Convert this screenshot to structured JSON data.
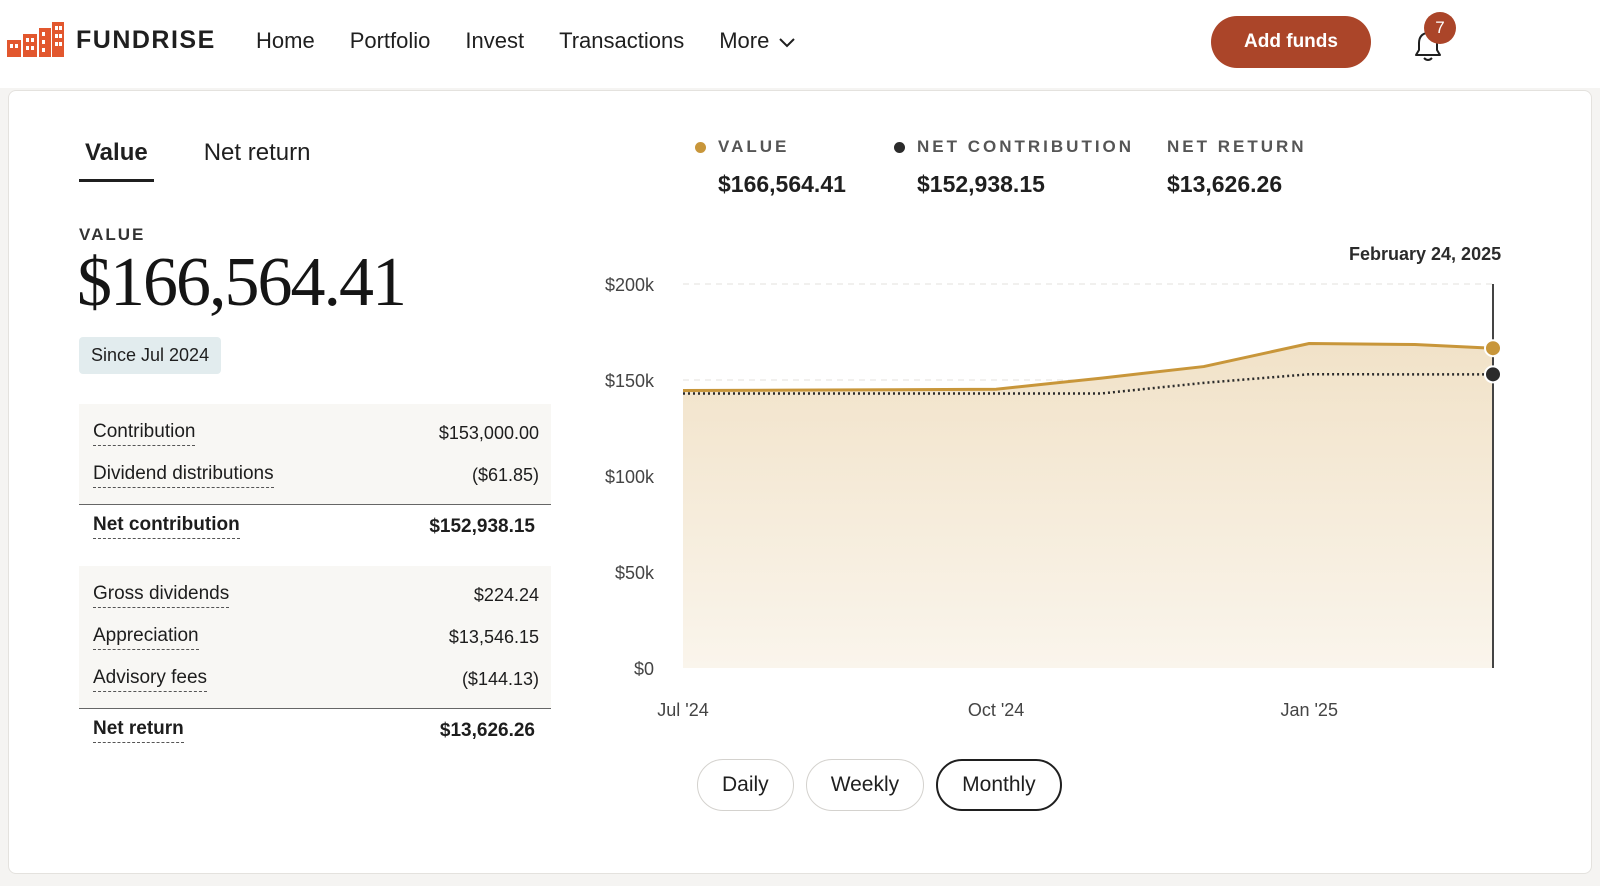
{
  "header": {
    "brand": "FUNDRISE",
    "nav": [
      {
        "label": "Home"
      },
      {
        "label": "Portfolio"
      },
      {
        "label": "Invest"
      },
      {
        "label": "Transactions"
      },
      {
        "label": "More"
      }
    ],
    "add_funds_label": "Add funds",
    "notification_count": "7"
  },
  "tabs": [
    {
      "label": "Value",
      "active": true
    },
    {
      "label": "Net return",
      "active": false
    }
  ],
  "summary": {
    "value_label": "VALUE",
    "value": "$166,564.41",
    "since": "Since Jul 2024"
  },
  "breakdown": {
    "contributions": [
      {
        "label": "Contribution",
        "value": "$153,000.00"
      },
      {
        "label": "Dividend distributions",
        "value": "($61.85)"
      }
    ],
    "net_contribution": {
      "label": "Net contribution",
      "value": "$152,938.15"
    },
    "returns": [
      {
        "label": "Gross dividends",
        "value": "$224.24"
      },
      {
        "label": "Appreciation",
        "value": "$13,546.15"
      },
      {
        "label": "Advisory fees",
        "value": "($144.13)"
      }
    ],
    "net_return": {
      "label": "Net return",
      "value": "$13,626.26"
    }
  },
  "legend": [
    {
      "label": "VALUE",
      "value": "$166,564.41",
      "color": "#c8963a"
    },
    {
      "label": "NET CONTRIBUTION",
      "value": "$152,938.15",
      "color": "#2b2b2b"
    },
    {
      "label": "NET RETURN",
      "value": "$13,626.26",
      "color": ""
    }
  ],
  "chart_data": {
    "type": "area",
    "x": [
      "2024-07-01",
      "2024-08-01",
      "2024-09-01",
      "2024-10-01",
      "2024-11-01",
      "2024-12-01",
      "2025-01-01",
      "2025-02-01",
      "2025-02-24"
    ],
    "x_tick_labels": [
      {
        "date": "2024-07-01",
        "label": "Jul '24"
      },
      {
        "date": "2024-10-01",
        "label": "Oct '24"
      },
      {
        "date": "2025-01-01",
        "label": "Jan '25"
      }
    ],
    "series": [
      {
        "name": "VALUE",
        "color": "#c8963a",
        "style": "solid-area",
        "values": [
          144500,
          144700,
          144900,
          145200,
          151000,
          157000,
          169000,
          168500,
          166564.41
        ]
      },
      {
        "name": "NET CONTRIBUTION",
        "color": "#2b2b2b",
        "style": "dotted",
        "values": [
          143000,
          143000,
          143000,
          143000,
          143000,
          148500,
          153000,
          152938.15,
          152938.15
        ]
      }
    ],
    "y_ticks": [
      0,
      50000,
      100000,
      150000,
      200000
    ],
    "y_tick_labels": [
      "$0",
      "$50k",
      "$100k",
      "$150k",
      "$200k"
    ],
    "ylim": [
      0,
      200000
    ],
    "grid": true,
    "selected_date_label": "February 24, 2025"
  },
  "periods": [
    {
      "label": "Daily",
      "selected": false
    },
    {
      "label": "Weekly",
      "selected": false
    },
    {
      "label": "Monthly",
      "selected": true
    }
  ]
}
